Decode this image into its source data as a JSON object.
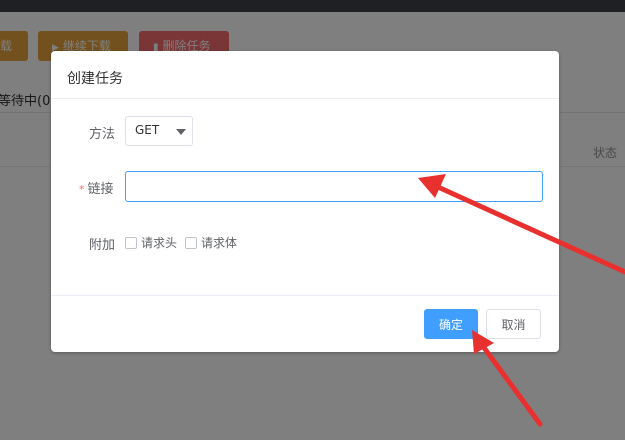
{
  "toolbar": {
    "download_label": "载",
    "continue_label": "继续下载",
    "delete_label": "删除任务"
  },
  "tabs": {
    "waiting_label": "等待中(0)"
  },
  "table": {
    "status_header": "状态"
  },
  "dialog": {
    "title": "创建任务",
    "method_label": "方法",
    "method_value": "GET",
    "url_label": "链接",
    "url_value": "",
    "extra_label": "附加",
    "headers_label": "请求头",
    "body_label": "请求体",
    "ok_label": "确定",
    "cancel_label": "取消"
  },
  "colors": {
    "primary": "#409eff",
    "warning": "#e6a23c",
    "danger": "#f56c6c",
    "annotation": "#e8312f"
  }
}
